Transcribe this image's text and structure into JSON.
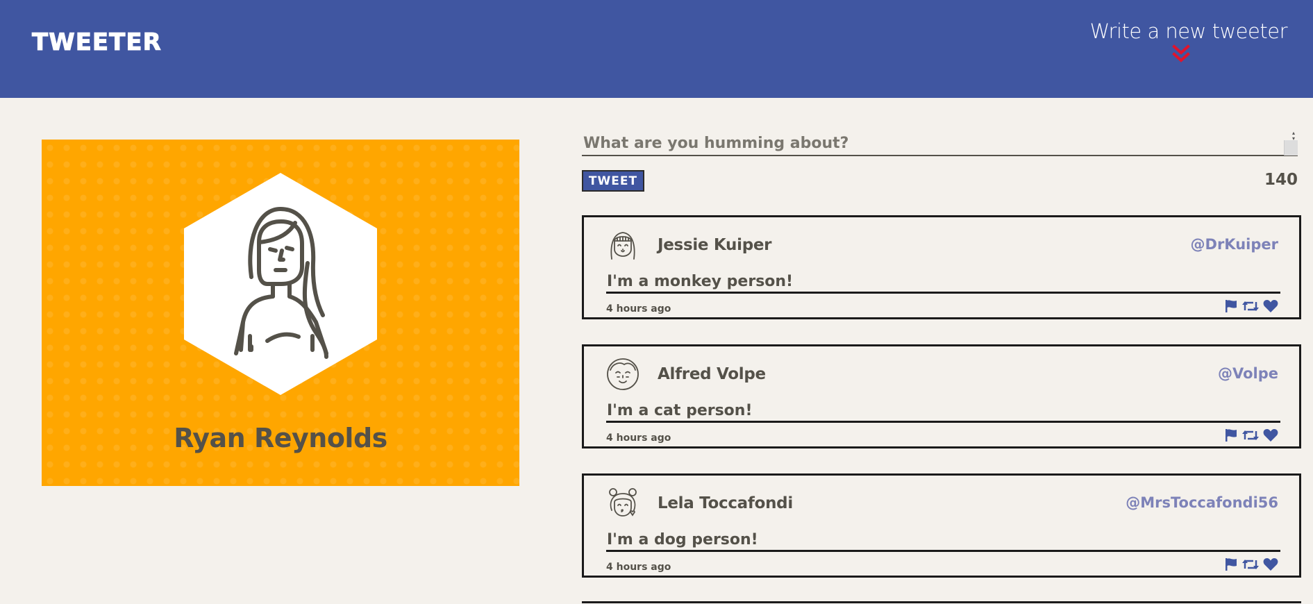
{
  "nav": {
    "brand": "Tweeter",
    "compose_label": "Write a new tweeter"
  },
  "colors": {
    "nav_bg": "#4056a1",
    "page_bg": "#f4f1ec",
    "profile_bg": "#ffa600",
    "handle": "#7d82b8",
    "chevron": "#e2132c",
    "action_icons": "#4056a1"
  },
  "profile": {
    "name": "Ryan Reynolds",
    "avatar_icon": "woman-avatar-icon"
  },
  "compose": {
    "placeholder": "What are you humming about?",
    "button_label": "Tweet",
    "counter": "140"
  },
  "tweets": [
    {
      "name": "Jessie Kuiper",
      "handle": "@DrKuiper",
      "content": "I'm a monkey person!",
      "time": "4 hours ago",
      "avatar_icon": "girl-bangs-avatar-icon"
    },
    {
      "name": "Alfred Volpe",
      "handle": "@Volpe",
      "content": "I'm a cat person!",
      "time": "4 hours ago",
      "avatar_icon": "boy-avatar-icon"
    },
    {
      "name": "Lela Toccafondi",
      "handle": "@MrsToccafondi56",
      "content": "I'm a dog person!",
      "time": "4 hours ago",
      "avatar_icon": "girl-buns-avatar-icon"
    }
  ],
  "action_icons": [
    "flag-icon",
    "retweet-icon",
    "heart-icon"
  ]
}
